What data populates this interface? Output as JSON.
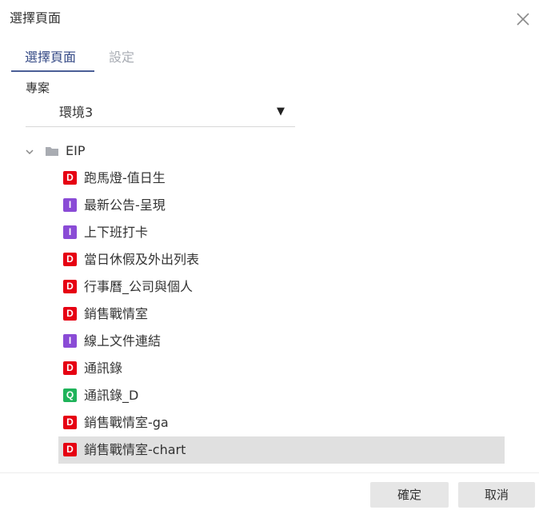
{
  "dialog": {
    "title": "選擇頁面",
    "close_icon": "close-icon"
  },
  "tabs": [
    {
      "label": "選擇頁面",
      "active": true
    },
    {
      "label": "設定",
      "active": false
    }
  ],
  "project": {
    "label": "專案",
    "value": "環境3",
    "caret": "▼"
  },
  "tree": {
    "root": {
      "label": "EIP",
      "expanded": true,
      "icon": "folder-icon"
    },
    "items": [
      {
        "badge": "D",
        "badge_color": "#e60012",
        "label": "跑馬燈-值日生",
        "selected": false
      },
      {
        "badge": "I",
        "badge_color": "#8a4bd6",
        "label": "最新公告-呈現",
        "selected": false
      },
      {
        "badge": "I",
        "badge_color": "#8a4bd6",
        "label": "上下班打卡",
        "selected": false
      },
      {
        "badge": "D",
        "badge_color": "#e60012",
        "label": "當日休假及外出列表",
        "selected": false
      },
      {
        "badge": "D",
        "badge_color": "#e60012",
        "label": "行事曆_公司與個人",
        "selected": false
      },
      {
        "badge": "D",
        "badge_color": "#e60012",
        "label": "銷售戰情室",
        "selected": false
      },
      {
        "badge": "I",
        "badge_color": "#8a4bd6",
        "label": "線上文件連結",
        "selected": false
      },
      {
        "badge": "D",
        "badge_color": "#e60012",
        "label": "通訊錄",
        "selected": false
      },
      {
        "badge": "Q",
        "badge_color": "#1fb35a",
        "label": "通訊錄_D",
        "selected": false
      },
      {
        "badge": "D",
        "badge_color": "#e60012",
        "label": "銷售戰情室-ga",
        "selected": false
      },
      {
        "badge": "D",
        "badge_color": "#e60012",
        "label": "銷售戰情室-chart",
        "selected": true
      }
    ]
  },
  "footer": {
    "ok_label": "確定",
    "cancel_label": "取消"
  }
}
